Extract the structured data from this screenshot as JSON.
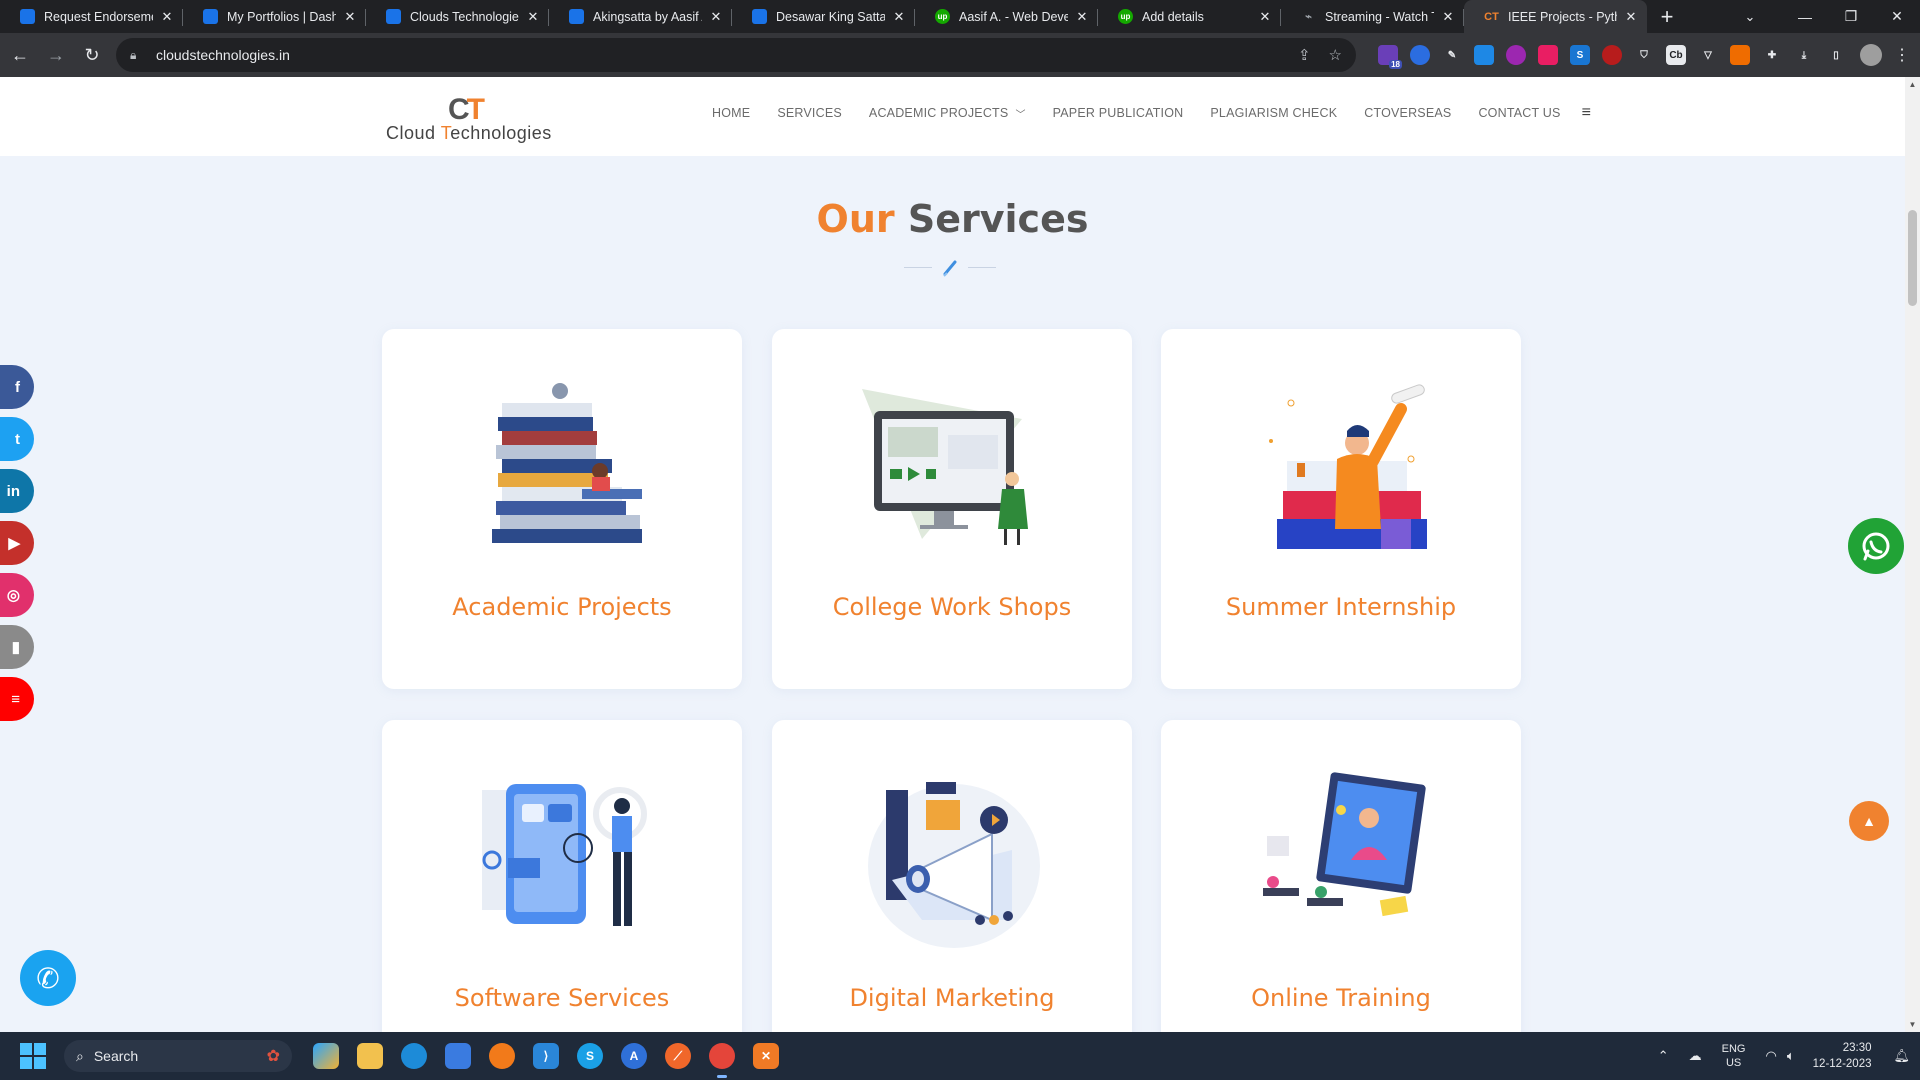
{
  "browser": {
    "tabs": [
      {
        "title": "Request Endorsement",
        "favicon": "blue"
      },
      {
        "title": "My Portfolios | Dashb",
        "favicon": "blue"
      },
      {
        "title": "Clouds Technologies |",
        "favicon": "blue"
      },
      {
        "title": "Akingsatta by Aasif Al",
        "favicon": "blue"
      },
      {
        "title": "Desawar King Satta b",
        "favicon": "blue"
      },
      {
        "title": "Aasif A. - Web Develo",
        "favicon": "green"
      },
      {
        "title": "Add details",
        "favicon": "green"
      },
      {
        "title": "Streaming - Watch TV",
        "favicon": "gray"
      },
      {
        "title": "IEEE Projects - Python",
        "favicon": "ct",
        "active": true
      }
    ],
    "url": "cloudstechnologies.in",
    "extension_badge": "18"
  },
  "site": {
    "logo": {
      "mark_c": "C",
      "mark_t": "T",
      "word_a": "Cloud ",
      "word_b": "T",
      "word_c": "echnologies"
    },
    "nav": [
      "HOME",
      "SERVICES",
      "ACADEMIC PROJECTS",
      "PAPER PUBLICATION",
      "PLAGIARISM CHECK",
      "CTOVERSEAS",
      "CONTACT US"
    ],
    "heading_a": "Our",
    "heading_b": "Services",
    "services": [
      {
        "label": "Academic Projects",
        "icon": "books-stack-illustration"
      },
      {
        "label": "College Work Shops",
        "icon": "monitor-workshop-illustration"
      },
      {
        "label": "Summer Internship",
        "icon": "graduate-diploma-illustration"
      },
      {
        "label": "Software Services",
        "icon": "mobile-dev-illustration"
      },
      {
        "label": "Digital Marketing",
        "icon": "megaphone-illustration"
      },
      {
        "label": "Online Training",
        "icon": "online-class-illustration"
      }
    ],
    "social": [
      {
        "name": "facebook",
        "glyph": "f",
        "color": "#3b5998"
      },
      {
        "name": "twitter",
        "glyph": "t",
        "color": "#1da1f2"
      },
      {
        "name": "linkedin",
        "glyph": "in",
        "color": "#0e76a8"
      },
      {
        "name": "youtube",
        "glyph": "▶",
        "color": "#c4302b"
      },
      {
        "name": "instagram",
        "glyph": "◎",
        "color": "#e1306c"
      },
      {
        "name": "document",
        "glyph": "▮",
        "color": "#8a8a8a"
      },
      {
        "name": "other",
        "glyph": "≡",
        "color": "#ff0000"
      }
    ]
  },
  "taskbar": {
    "search_placeholder": "Search",
    "lang_1": "ENG",
    "lang_2": "US",
    "time": "23:30",
    "date": "12-12-2023"
  },
  "colors": {
    "accent": "#f0822f",
    "heading_dark": "#555555",
    "page_bg": "#eef3fb"
  }
}
